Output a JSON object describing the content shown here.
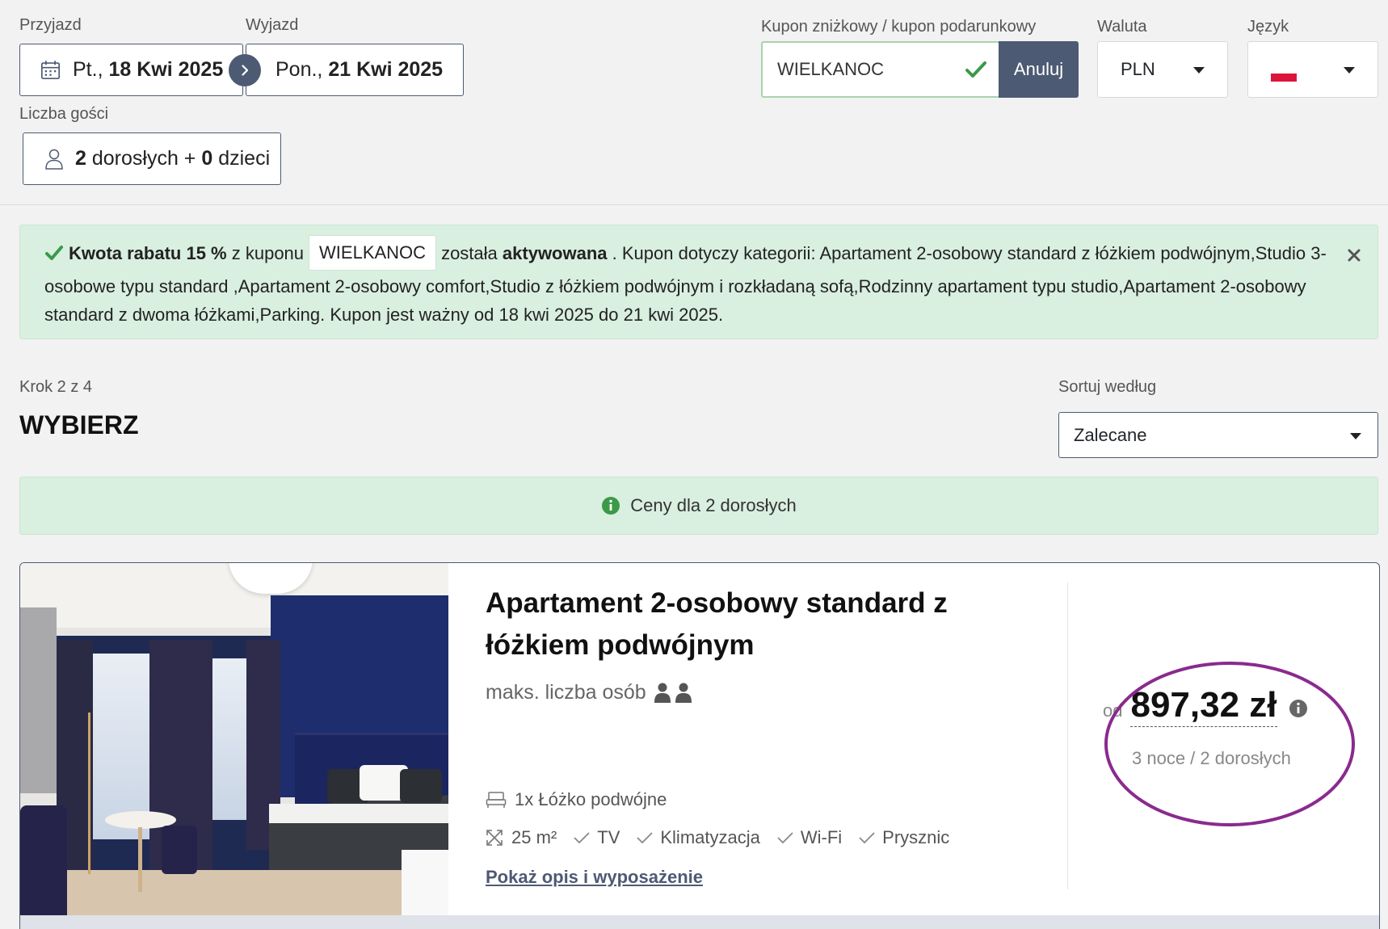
{
  "search": {
    "checkin_label": "Przyjazd",
    "checkin_prefix": "Pt.,",
    "checkin_date": "18 Kwi 2025",
    "checkout_label": "Wyjazd",
    "checkout_prefix": "Pon.,",
    "checkout_date": "21 Kwi 2025",
    "guests_label": "Liczba gości",
    "adults_count": "2",
    "adults_text": "dorosłych +",
    "children_count": "0",
    "children_text": "dzieci"
  },
  "coupon": {
    "label": "Kupon zniżkowy / kupon podarunkowy",
    "value": "WIELKANOC",
    "cancel_label": "Anuluj"
  },
  "currency": {
    "label": "Waluta",
    "value": "PLN"
  },
  "language": {
    "label": "Język",
    "flag": "pl-flag"
  },
  "alert": {
    "strong1": "Kwota rabatu 15 %",
    "text1": "z kuponu",
    "coupon": "WIELKANOC",
    "text2": "została",
    "strong2": "aktywowana",
    "text3": ". Kupon dotyczy kategorii: Apartament 2-osobowy standard z łóżkiem podwójnym,Studio 3-osobowe typu standard ,Apartament 2-osobowy comfort,Studio z łóżkiem podwójnym i rozkładaną sofą,Rodzinny apartament typu studio,Apartament 2-osobowy standard z dwoma łóżkami,Parking. Kupon jest ważny od 18 kwi 2025 do 21 kwi 2025."
  },
  "step": {
    "counter": "Krok 2 z 4",
    "title": "WYBIERZ"
  },
  "sort": {
    "label": "Sortuj według",
    "value": "Zalecane"
  },
  "info_bar": {
    "text": "Ceny dla 2 dorosłych"
  },
  "room": {
    "title": "Apartament 2-osobowy standard z łóżkiem podwójnym",
    "max_persons": "maks. liczba osób",
    "bed": "1x Łóżko podwójne",
    "area": "25 m²",
    "amenities": [
      "TV",
      "Klimatyzacja",
      "Wi-Fi",
      "Prysznic"
    ],
    "details_link": "Pokaż opis i wyposażenie",
    "price_prefix": "od",
    "price": "897,32 zł",
    "price_note": "3 noce / 2 dorosłych"
  },
  "colors": {
    "accent": "#4d5a73",
    "success": "#3a9a48",
    "alert_bg": "#d9efe0",
    "highlight": "#8a2a8e"
  }
}
